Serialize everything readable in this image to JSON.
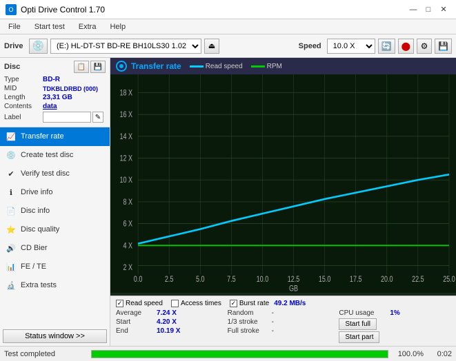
{
  "titleBar": {
    "title": "Opti Drive Control 1.70",
    "controls": [
      "—",
      "□",
      "✕"
    ]
  },
  "menuBar": {
    "items": [
      "File",
      "Start test",
      "Extra",
      "Help"
    ]
  },
  "toolbar": {
    "driveLabel": "Drive",
    "driveValue": "(E:)  HL-DT-ST BD-RE  BH10LS30 1.02",
    "speedLabel": "Speed",
    "speedValue": "10.0 X"
  },
  "disc": {
    "sectionLabel": "Disc",
    "typeKey": "Type",
    "typeVal": "BD-R",
    "midKey": "MID",
    "midVal": "TDKBLDRBD (000)",
    "lengthKey": "Length",
    "lengthVal": "23,31 GB",
    "contentsKey": "Contents",
    "contentsVal": "data",
    "labelKey": "Label",
    "labelVal": ""
  },
  "nav": {
    "items": [
      {
        "id": "transfer-rate",
        "label": "Transfer rate",
        "active": true
      },
      {
        "id": "create-test-disc",
        "label": "Create test disc",
        "active": false
      },
      {
        "id": "verify-test-disc",
        "label": "Verify test disc",
        "active": false
      },
      {
        "id": "drive-info",
        "label": "Drive info",
        "active": false
      },
      {
        "id": "disc-info",
        "label": "Disc info",
        "active": false
      },
      {
        "id": "disc-quality",
        "label": "Disc quality",
        "active": false
      },
      {
        "id": "cd-bier",
        "label": "CD Bier",
        "active": false
      },
      {
        "id": "fe-te",
        "label": "FE / TE",
        "active": false
      },
      {
        "id": "extra-tests",
        "label": "Extra tests",
        "active": false
      }
    ]
  },
  "statusWindowBtn": "Status window >>",
  "chart": {
    "title": "Transfer rate",
    "legendReadSpeed": "Read speed",
    "legendRPM": "RPM",
    "xAxis": {
      "labels": [
        "0.0",
        "2.5",
        "5.0",
        "7.5",
        "10.0",
        "12.5",
        "15.0",
        "17.5",
        "20.0",
        "22.5",
        "25.0"
      ],
      "unit": "GB"
    },
    "yAxis": {
      "labels": [
        "2 X",
        "4 X",
        "6 X",
        "8 X",
        "10 X",
        "12 X",
        "14 X",
        "16 X",
        "18 X"
      ]
    }
  },
  "checkboxes": {
    "readSpeed": {
      "label": "Read speed",
      "checked": true
    },
    "accessTimes": {
      "label": "Access times",
      "checked": false
    },
    "burstRate": {
      "label": "Burst rate",
      "checked": true,
      "value": "49.2 MB/s"
    }
  },
  "stats": {
    "averageKey": "Average",
    "averageVal": "7.24 X",
    "randomKey": "Random",
    "randomVal": "-",
    "cpuUsageKey": "CPU usage",
    "cpuUsageVal": "1%",
    "startKey": "Start",
    "startVal": "4.20 X",
    "strokeKey": "1/3 stroke",
    "strokeVal": "-",
    "endKey": "End",
    "endVal": "10.19 X",
    "fullStrokeKey": "Full stroke",
    "fullStrokeVal": "-"
  },
  "buttons": {
    "startFull": "Start full",
    "startPart": "Start part"
  },
  "statusBar": {
    "text": "Test completed",
    "progress": 100,
    "percent": "100.0%",
    "time": "0:02"
  }
}
